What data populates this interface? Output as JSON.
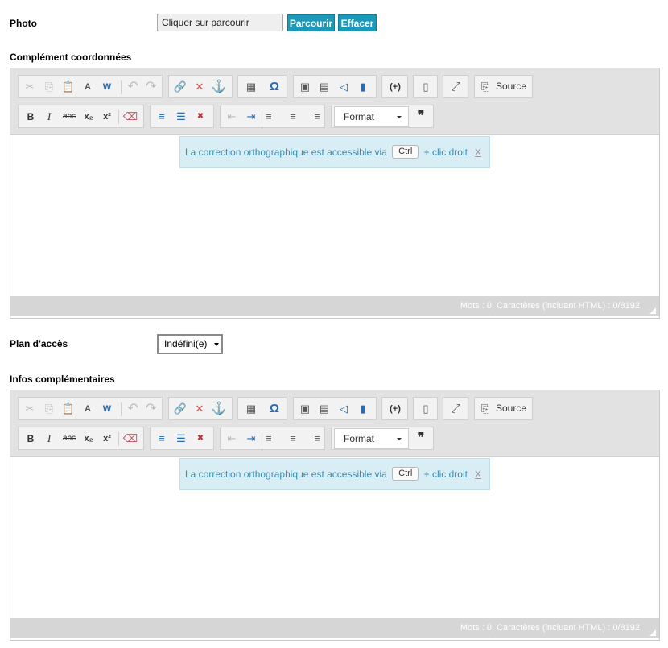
{
  "photo": {
    "label": "Photo",
    "field_value": "Cliquer sur parcourir",
    "browse_label": "Parcourir",
    "clear_label": "Effacer"
  },
  "editor1": {
    "label": "Complément coordonnées",
    "source_label": "Source",
    "format_label": "Format",
    "notice_text": "La correction orthographique est accessible via",
    "notice_key": "Ctrl",
    "notice_suffix": "+ clic droit",
    "notice_close": "X",
    "wordcount": "Mots : 0, Caractères (incluant HTML) : 0/8192"
  },
  "plan": {
    "label": "Plan d'accès",
    "selected": "Indéfini(e)"
  },
  "editor2": {
    "label": "Infos complémentaires",
    "source_label": "Source",
    "format_label": "Format",
    "notice_text": "La correction orthographique est accessible via",
    "notice_key": "Ctrl",
    "notice_suffix": "+ clic droit",
    "notice_close": "X",
    "wordcount": "Mots : 0, Caractères (incluant HTML) : 0/8192"
  },
  "icons": {
    "cut": "✂",
    "copy": "⎘",
    "paste": "📋",
    "paste_text": "A",
    "paste_word": "W",
    "undo": "↶",
    "redo": "↷",
    "link": "🔗",
    "unlink": "✕",
    "anchor": "⚓",
    "table": "▦",
    "special_char": "Ω",
    "image": "▣",
    "video": "▤",
    "audio": "◁",
    "flash": "▮",
    "plugin": "(+)",
    "template": "▯",
    "maximize": "⤢",
    "source": "⎘",
    "bold": "B",
    "italic": "I",
    "strike": "abc",
    "subscript": "x₂",
    "superscript": "x²",
    "remove_format": "⌫",
    "ordered_list": "≡",
    "bullet_list": "☰",
    "remove_list": "✖",
    "outdent": "⇤",
    "indent": "⇥",
    "align_left": "≡",
    "align_center": "≡",
    "align_right": "≡",
    "blockquote": "❞"
  },
  "colors": {
    "accent": "#1b99b8",
    "notice_bg": "#d9edf4",
    "notice_text": "#3b8eb1",
    "toolbar_bg": "#e2e2e2"
  }
}
